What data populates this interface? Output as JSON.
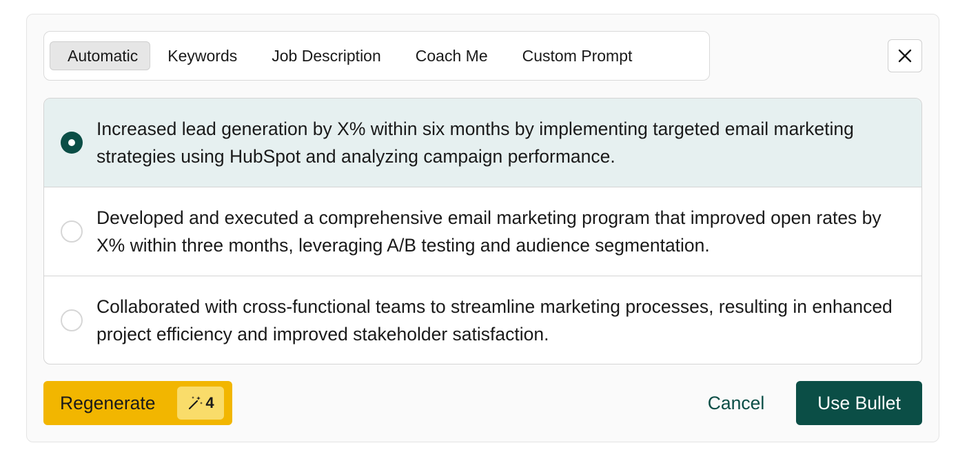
{
  "tabs": [
    {
      "label": "Automatic",
      "active": true
    },
    {
      "label": "Keywords",
      "active": false
    },
    {
      "label": "Job Description",
      "active": false
    },
    {
      "label": "Coach Me",
      "active": false
    },
    {
      "label": "Custom Prompt",
      "active": false
    }
  ],
  "close_icon": "close-icon",
  "options": [
    {
      "text": "Increased lead generation by X% within six months by implementing targeted email marketing strategies using HubSpot and analyzing campaign performance.",
      "selected": true
    },
    {
      "text": "Developed and executed a comprehensive email marketing program that improved open rates by X% within three months, leveraging A/B testing and audience segmentation.",
      "selected": false
    },
    {
      "text": "Collaborated with cross-functional teams to streamline marketing processes, resulting in enhanced project efficiency and improved stakeholder satisfaction.",
      "selected": false
    }
  ],
  "actions": {
    "regenerate_label": "Regenerate",
    "regenerate_icon": "magic-wand-icon",
    "credits": "4",
    "cancel_label": "Cancel",
    "use_bullet_label": "Use Bullet"
  },
  "colors": {
    "accent": "#0b4e46",
    "regenerate_bg": "#f2b600",
    "badge_bg": "#f9dc6a",
    "selected_row_bg": "#e6f0f0"
  }
}
